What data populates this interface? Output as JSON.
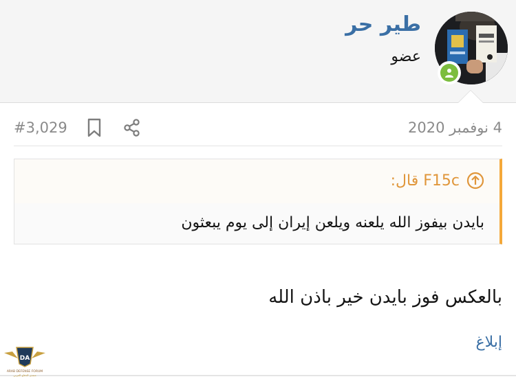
{
  "header": {
    "username": "طير حر",
    "user_title": "عضو"
  },
  "post": {
    "date": "4 نوفمبر 2020",
    "number": "#3,029",
    "quote_author": "F15c قال:",
    "quote_text": "بايدن بيفوز الله يلعنه ويلعن إيران إلى يوم يبعثون",
    "body_text": "بالعكس فوز بايدن خير باذن الله",
    "report_label": "إبلاغ"
  },
  "watermark": {
    "badge": "DA",
    "line1": "ARAB DEFENSE FORUM",
    "line2": "منتدى الدفاع العربي"
  },
  "colors": {
    "username": "#3a6fa5",
    "quote_accent": "#f4a83a",
    "online": "#7cbd3e",
    "meta": "#8a8a8a"
  }
}
